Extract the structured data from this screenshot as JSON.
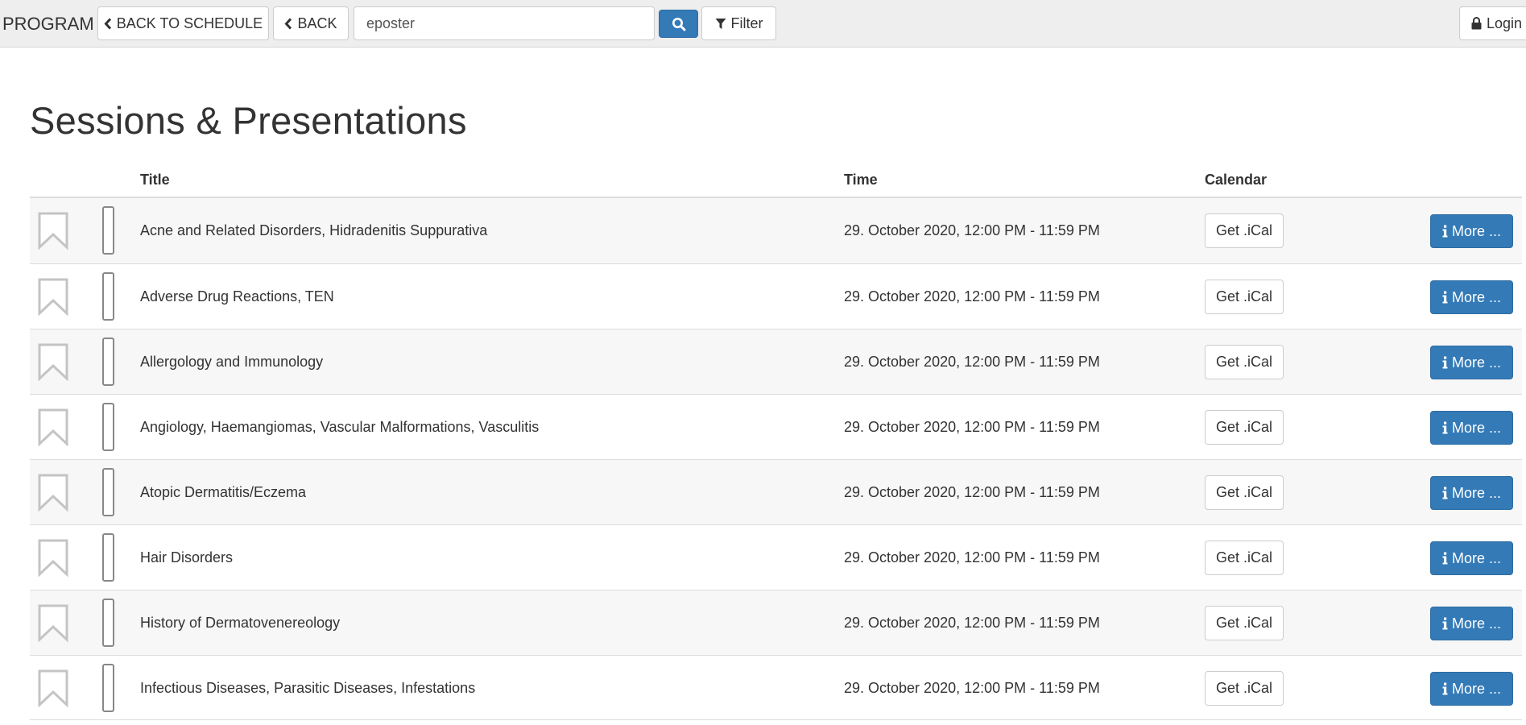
{
  "navbar": {
    "brand": "PROGRAM",
    "back_to_schedule_label": "BACK TO SCHEDULE",
    "back_label": "BACK",
    "search_value": "eposter",
    "filter_label": "Filter",
    "login_label": "Login"
  },
  "icons": {
    "back_to_schedule": "chevron-left-icon",
    "back": "chevron-left-icon",
    "search": "search-icon",
    "filter": "filter-icon",
    "login": "lock-icon",
    "bookmark": "bookmark-icon",
    "more": "info-icon"
  },
  "colors": {
    "primary": "#337ab7",
    "navbar_bg": "#eeeeee",
    "row_stripe": "#f7f7f7"
  },
  "page": {
    "title": "Sessions & Presentations"
  },
  "table": {
    "columns": {
      "title": "Title",
      "time": "Time",
      "calendar": "Calendar"
    },
    "rows": [
      {
        "title": "Acne and Related Disorders, Hidradenitis Suppurativa",
        "time": "29. October 2020, 12:00 PM - 11:59 PM",
        "ical_label": "Get .iCal",
        "more_label": "More ..."
      },
      {
        "title": "Adverse Drug Reactions, TEN",
        "time": "29. October 2020, 12:00 PM - 11:59 PM",
        "ical_label": "Get .iCal",
        "more_label": "More ..."
      },
      {
        "title": "Allergology and Immunology",
        "time": "29. October 2020, 12:00 PM - 11:59 PM",
        "ical_label": "Get .iCal",
        "more_label": "More ..."
      },
      {
        "title": "Angiology, Haemangiomas, Vascular Malformations, Vasculitis",
        "time": "29. October 2020, 12:00 PM - 11:59 PM",
        "ical_label": "Get .iCal",
        "more_label": "More ..."
      },
      {
        "title": "Atopic Dermatitis/Eczema",
        "time": "29. October 2020, 12:00 PM - 11:59 PM",
        "ical_label": "Get .iCal",
        "more_label": "More ..."
      },
      {
        "title": "Hair Disorders",
        "time": "29. October 2020, 12:00 PM - 11:59 PM",
        "ical_label": "Get .iCal",
        "more_label": "More ..."
      },
      {
        "title": "History of Dermatovenereology",
        "time": "29. October 2020, 12:00 PM - 11:59 PM",
        "ical_label": "Get .iCal",
        "more_label": "More ..."
      },
      {
        "title": "Infectious Diseases, Parasitic Diseases, Infestations",
        "time": "29. October 2020, 12:00 PM - 11:59 PM",
        "ical_label": "Get .iCal",
        "more_label": "More ..."
      }
    ]
  }
}
